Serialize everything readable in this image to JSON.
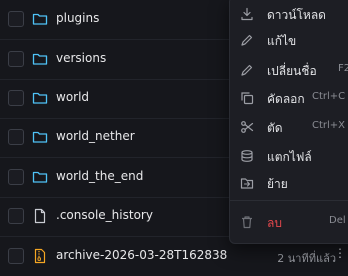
{
  "colors": {
    "background": "#16171c",
    "folder_icon": "#4fc3f7",
    "archive_icon": "#f5a623",
    "danger": "#e5484d"
  },
  "files": [
    {
      "name": "plugins",
      "icon": "folder-icon",
      "date": ""
    },
    {
      "name": "versions",
      "icon": "folder-icon",
      "date": ""
    },
    {
      "name": "world",
      "icon": "folder-icon",
      "date": ""
    },
    {
      "name": "world_nether",
      "icon": "folder-icon",
      "date": ""
    },
    {
      "name": "world_the_end",
      "icon": "folder-icon",
      "date": ""
    },
    {
      "name": ".console_history",
      "icon": "file-icon",
      "date": ""
    },
    {
      "name": "archive-2026-03-28T162838...",
      "icon": "archive-icon",
      "date": "2 นาทีที่แล้ว",
      "more": "⋮"
    }
  ],
  "context_menu": {
    "items": [
      {
        "label": "ดาวน์โหลด",
        "shortcut": "",
        "icon": "download-icon"
      },
      {
        "label": "แก้ไข",
        "shortcut": "",
        "icon": "pencil-icon"
      },
      {
        "label": "เปลี่ยนชื่อ",
        "shortcut": "F2",
        "icon": "rename-icon"
      },
      {
        "label": "คัดลอก",
        "shortcut": "Ctrl+C",
        "icon": "copy-icon"
      },
      {
        "label": "ตัด",
        "shortcut": "Ctrl+X",
        "icon": "scissors-icon"
      },
      {
        "label": "แตกไฟล์",
        "shortcut": "",
        "icon": "extract-icon"
      },
      {
        "label": "ย้าย",
        "shortcut": "",
        "icon": "move-icon"
      },
      {
        "label": "ลบ",
        "shortcut": "Del",
        "icon": "trash-icon"
      }
    ]
  }
}
